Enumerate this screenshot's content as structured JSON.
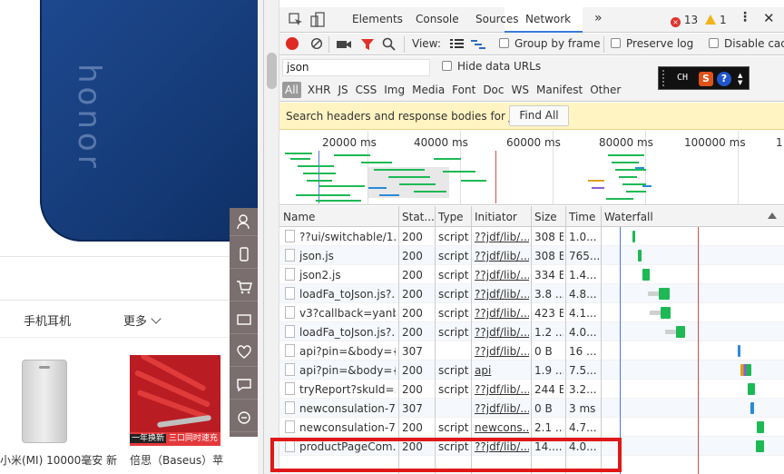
{
  "page": {
    "phone_logo": "honor",
    "subnav": {
      "item1": "手机耳机",
      "more": "更多"
    },
    "products": [
      {
        "caption": "小米(MI) 10000毫安 新"
      },
      {
        "caption": "倍思（Baseus）苹",
        "banner_left": "一年换新",
        "banner_right": "三口同时速充"
      }
    ],
    "side_tools": [
      "user-icon",
      "phone-icon",
      "cart-icon",
      "ticket-icon",
      "heart-icon",
      "chat-icon",
      "feedback-icon"
    ]
  },
  "devtools": {
    "tabs": [
      "Elements",
      "Console",
      "Sources",
      "Network"
    ],
    "active_tab": "Network",
    "more_tabs": "»",
    "errors": "13",
    "warnings": "1",
    "toolbar": {
      "view_label": "View:",
      "group_by_frame": "Group by frame",
      "preserve_log": "Preserve log",
      "disable_cache": "Disable cac"
    },
    "filter": {
      "value": "json",
      "hide_data_urls": "Hide data URLs",
      "types": [
        "All",
        "XHR",
        "JS",
        "CSS",
        "Img",
        "Media",
        "Font",
        "Doc",
        "WS",
        "Manifest",
        "Other"
      ]
    },
    "ch_widget": {
      "label": "CH",
      "s": "S",
      "q": "?"
    },
    "search_banner": {
      "prefix": "Search headers and response bodies for ",
      "term": "json",
      "button": "Find All"
    },
    "overview_ticks": [
      "20000 ms",
      "40000 ms",
      "60000 ms",
      "80000 ms",
      "100000 ms",
      "1"
    ],
    "columns": [
      "Name",
      "Stat...",
      "Type",
      "Initiator",
      "Size",
      "Time",
      "Waterfall"
    ],
    "rows": [
      {
        "name": "??ui/switchable/1...",
        "status": "200",
        "type": "script",
        "initiator": "??jdf/lib/...",
        "size": "308 B",
        "time": "1.0..."
      },
      {
        "name": "json.js",
        "status": "200",
        "type": "script",
        "initiator": "??jdf/lib/...",
        "size": "308 B",
        "time": "765..."
      },
      {
        "name": "json2.js",
        "status": "200",
        "type": "script",
        "initiator": "??jdf/lib/...",
        "size": "334 B",
        "time": "1.4..."
      },
      {
        "name": "loadFa_toJson.js?...",
        "status": "200",
        "type": "script",
        "initiator": "??jdf/lib/...",
        "size": "3.8 ...",
        "time": "4.8..."
      },
      {
        "name": "v3?callback=yanb...",
        "status": "200",
        "type": "script",
        "initiator": "??jdf/lib/...",
        "size": "423 B",
        "time": "4.1..."
      },
      {
        "name": "loadFa_toJson.js?...",
        "status": "200",
        "type": "script",
        "initiator": "??jdf/lib/...",
        "size": "1.2 ...",
        "time": "4.0..."
      },
      {
        "name": "api?pin=&body={...",
        "status": "307",
        "type": "",
        "initiator": "??jdf/lib/...",
        "size": "0 B",
        "time": "16 ..."
      },
      {
        "name": "api?pin=&body={...",
        "status": "200",
        "type": "script",
        "initiator": "api",
        "size": "1.9 ...",
        "time": "7.5..."
      },
      {
        "name": "tryReport?skuId=...",
        "status": "200",
        "type": "script",
        "initiator": "??jdf/lib/...",
        "size": "244 B",
        "time": "3.2..."
      },
      {
        "name": "newconsulation-7...",
        "status": "307",
        "type": "",
        "initiator": "??jdf/lib/...",
        "size": "0 B",
        "time": "3 ms"
      },
      {
        "name": "newconsulation-7...",
        "status": "200",
        "type": "script",
        "initiator": "newcons...",
        "size": "2.1 ...",
        "time": "4.7..."
      },
      {
        "name": "productPageCom...",
        "status": "200",
        "type": "script",
        "initiator": "??jdf/lib/...",
        "size": "14....",
        "time": "4.0..."
      }
    ],
    "colors": {
      "accent": "#3879d9",
      "record": "#e02a26",
      "highlight_box": "#e01818",
      "wf_green": "#1db954"
    }
  }
}
